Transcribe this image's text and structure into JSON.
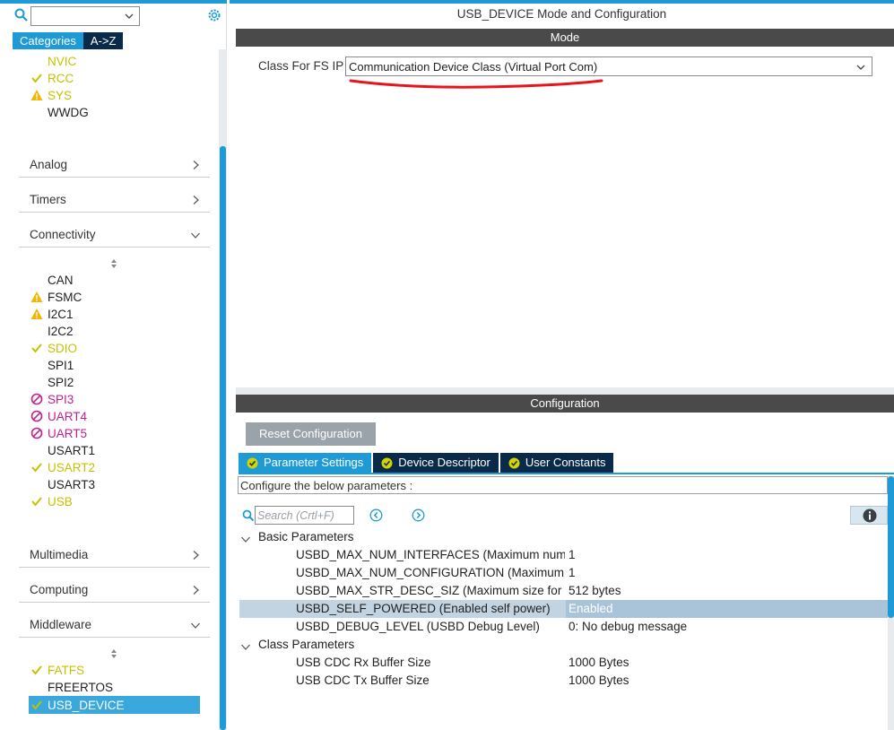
{
  "left_panel": {
    "tabs": [
      "Categories",
      "A->Z"
    ],
    "system_core_items": [
      {
        "label": "NVIC",
        "status": "ok-plain"
      },
      {
        "label": "RCC",
        "status": "ok"
      },
      {
        "label": "SYS",
        "status": "warn"
      },
      {
        "label": "WWDG",
        "status": "none"
      }
    ],
    "categories": {
      "analog": "Analog",
      "timers": "Timers",
      "connectivity": "Connectivity",
      "multimedia": "Multimedia",
      "computing": "Computing",
      "middleware": "Middleware"
    },
    "connectivity_items": [
      {
        "label": "CAN",
        "status": "none"
      },
      {
        "label": "FSMC",
        "status": "warn"
      },
      {
        "label": "I2C1",
        "status": "warn"
      },
      {
        "label": "I2C2",
        "status": "none"
      },
      {
        "label": "SDIO",
        "status": "ok"
      },
      {
        "label": "SPI1",
        "status": "none"
      },
      {
        "label": "SPI2",
        "status": "none"
      },
      {
        "label": "SPI3",
        "status": "err"
      },
      {
        "label": "UART4",
        "status": "err"
      },
      {
        "label": "UART5",
        "status": "err"
      },
      {
        "label": "USART1",
        "status": "none"
      },
      {
        "label": "USART2",
        "status": "ok"
      },
      {
        "label": "USART3",
        "status": "none"
      },
      {
        "label": "USB",
        "status": "ok"
      }
    ],
    "middleware_items": [
      {
        "label": "FATFS",
        "status": "ok"
      },
      {
        "label": "FREERTOS",
        "status": "none"
      },
      {
        "label": "USB_DEVICE",
        "status": "ok"
      }
    ]
  },
  "right_panel": {
    "title": "USB_DEVICE Mode and Configuration",
    "mode_header": "Mode",
    "class_label": "Class For FS IP",
    "class_value": "Communication Device Class (Virtual Port Com)",
    "config_header": "Configuration",
    "reset_button": "Reset Configuration",
    "tabs": [
      "Parameter Settings",
      "Device Descriptor",
      "User Constants"
    ],
    "description": "Configure the below parameters :",
    "search_placeholder": "Search (Crtl+F)",
    "groups": {
      "basic": "Basic Parameters",
      "class": "Class Parameters"
    },
    "basic_params": [
      {
        "name": "USBD_MAX_NUM_INTERFACES (Maximum num...",
        "value": "1"
      },
      {
        "name": "USBD_MAX_NUM_CONFIGURATION (Maximum ...",
        "value": "1"
      },
      {
        "name": "USBD_MAX_STR_DESC_SIZ (Maximum size for ...",
        "value": "512 bytes"
      },
      {
        "name": "USBD_SELF_POWERED (Enabled self power)",
        "value": "Enabled"
      },
      {
        "name": "USBD_DEBUG_LEVEL (USBD Debug Level)",
        "value": "0: No debug message"
      }
    ],
    "class_params": [
      {
        "name": "USB CDC Rx Buffer Size",
        "value": "1000 Bytes"
      },
      {
        "name": "USB CDC Tx Buffer Size",
        "value": "1000 Bytes"
      }
    ]
  },
  "colors": {
    "accent": "#1e9bd7",
    "dark_tab": "#0a2a4a",
    "ok": "#c3c200",
    "error": "#c0208e",
    "annotation": "#e8141b"
  }
}
